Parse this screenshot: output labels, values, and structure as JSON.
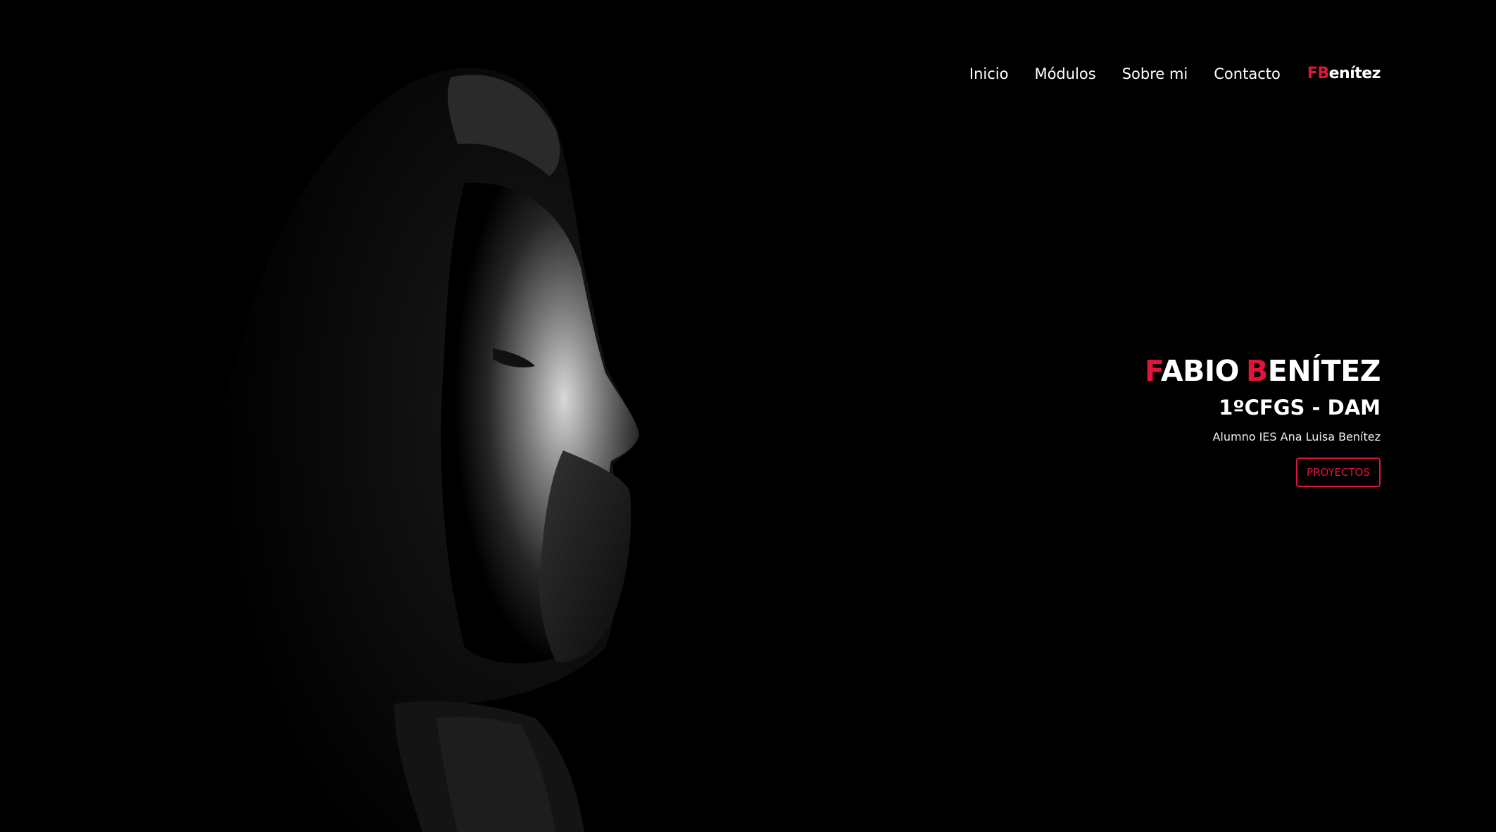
{
  "nav": {
    "items": [
      {
        "label": "Inicio"
      },
      {
        "label": "Módulos"
      },
      {
        "label": "Sobre mi"
      },
      {
        "label": "Contacto"
      }
    ],
    "brand": {
      "initials": "FB",
      "rest": "enítez"
    }
  },
  "hero": {
    "name": {
      "first_initial": "F",
      "first_rest": "ABIO",
      "last_initial": "B",
      "last_rest": "ENÍTEZ"
    },
    "course": "1ºCFGS - DAM",
    "subtitle": "Alumno IES Ana Luisa Benítez",
    "button_label": "PROYECTOS"
  },
  "colors": {
    "accent": "#e0153a",
    "background": "#000000",
    "text": "#ffffff"
  }
}
